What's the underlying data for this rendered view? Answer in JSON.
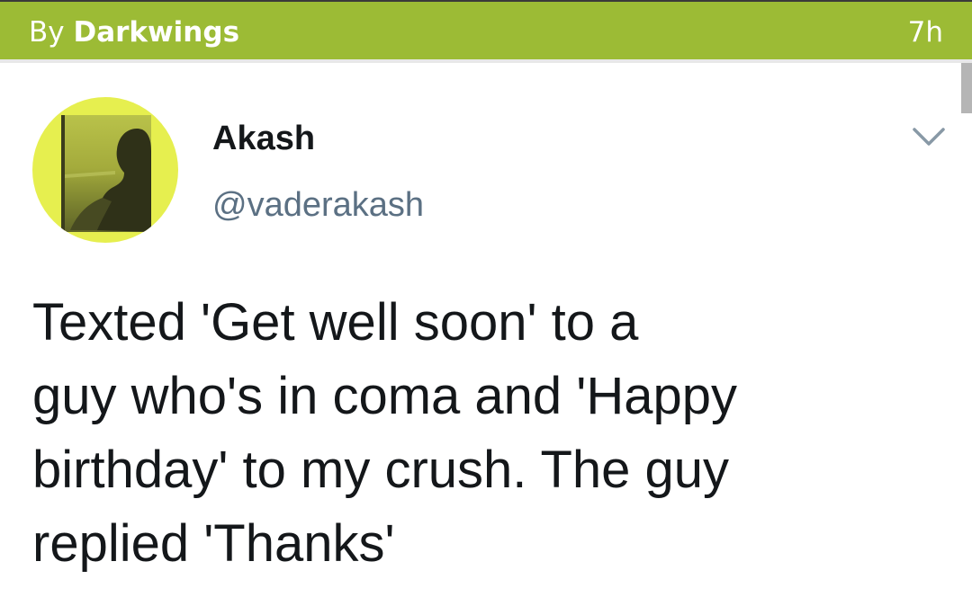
{
  "header": {
    "by_label": "By",
    "author": "Darkwings",
    "time": "7h",
    "bar_color": "#9cbb35"
  },
  "tweet": {
    "avatar_icon": "profile-photo",
    "avatar_bg_color": "#e6ef4f",
    "display_name": "Akash",
    "handle": "@vaderakash",
    "menu_icon": "chevron-down-icon",
    "text_lines": [
      "Texted 'Get well soon' to a",
      "guy who's in coma and 'Happy",
      "birthday' to my crush. The guy",
      "replied 'Thanks'"
    ]
  }
}
